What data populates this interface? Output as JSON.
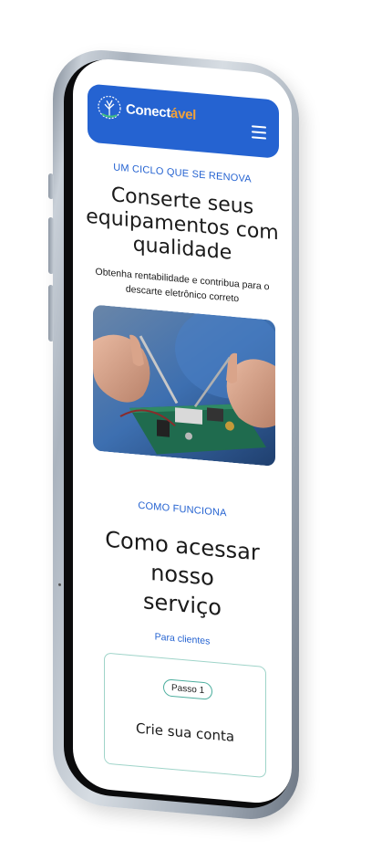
{
  "header": {
    "logo_prefix": "Conect",
    "logo_suffix": "ável",
    "menu_icon": "hamburger-menu-icon",
    "bg_color": "#2563d1",
    "accent_color": "#f2a23a"
  },
  "hero": {
    "eyebrow": "UM CICLO QUE SE RENOVA",
    "title_line1": "Conserte seus",
    "title_line2": "equipamentos com",
    "title_line3": "qualidade",
    "subtitle_line1": "Obtenha rentabilidade e contribua para o",
    "subtitle_line2": "descarte eletrônico correto",
    "image_icon": "circuit-board-repair-photo"
  },
  "how_it_works": {
    "eyebrow": "COMO FUNCIONA",
    "title_line1": "Como acessar",
    "title_line2": "nosso",
    "title_line3": "serviço",
    "audience_link": "Para clientes",
    "steps": [
      {
        "badge": "Passo 1",
        "title": "Crie sua conta"
      }
    ]
  }
}
